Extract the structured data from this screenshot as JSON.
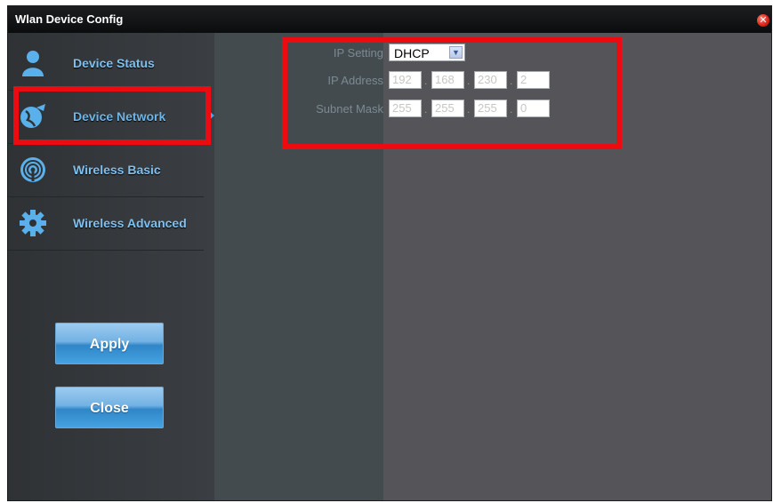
{
  "window": {
    "title": "Wlan Device Config",
    "close_icon": "close-icon"
  },
  "sidebar": {
    "items": [
      {
        "label": "Device Status",
        "icon": "person-icon"
      },
      {
        "label": "Device Network",
        "icon": "globe-plug-icon"
      },
      {
        "label": "Wireless Basic",
        "icon": "wireless-icon"
      },
      {
        "label": "Wireless Advanced",
        "icon": "gear-icon"
      }
    ],
    "active_index": 1,
    "apply_label": "Apply",
    "close_label": "Close"
  },
  "form": {
    "ip_setting_label": "IP Setting",
    "ip_setting_value": "DHCP",
    "ip_address_label": "IP Address",
    "ip_address": [
      "192",
      "168",
      "230",
      "2"
    ],
    "subnet_mask_label": "Subnet Mask",
    "subnet_mask": [
      "255",
      "255",
      "255",
      "0"
    ]
  },
  "colors": {
    "accent": "#7ec0ef",
    "highlight": "#ec0b10",
    "panel": "#3b3f43"
  }
}
